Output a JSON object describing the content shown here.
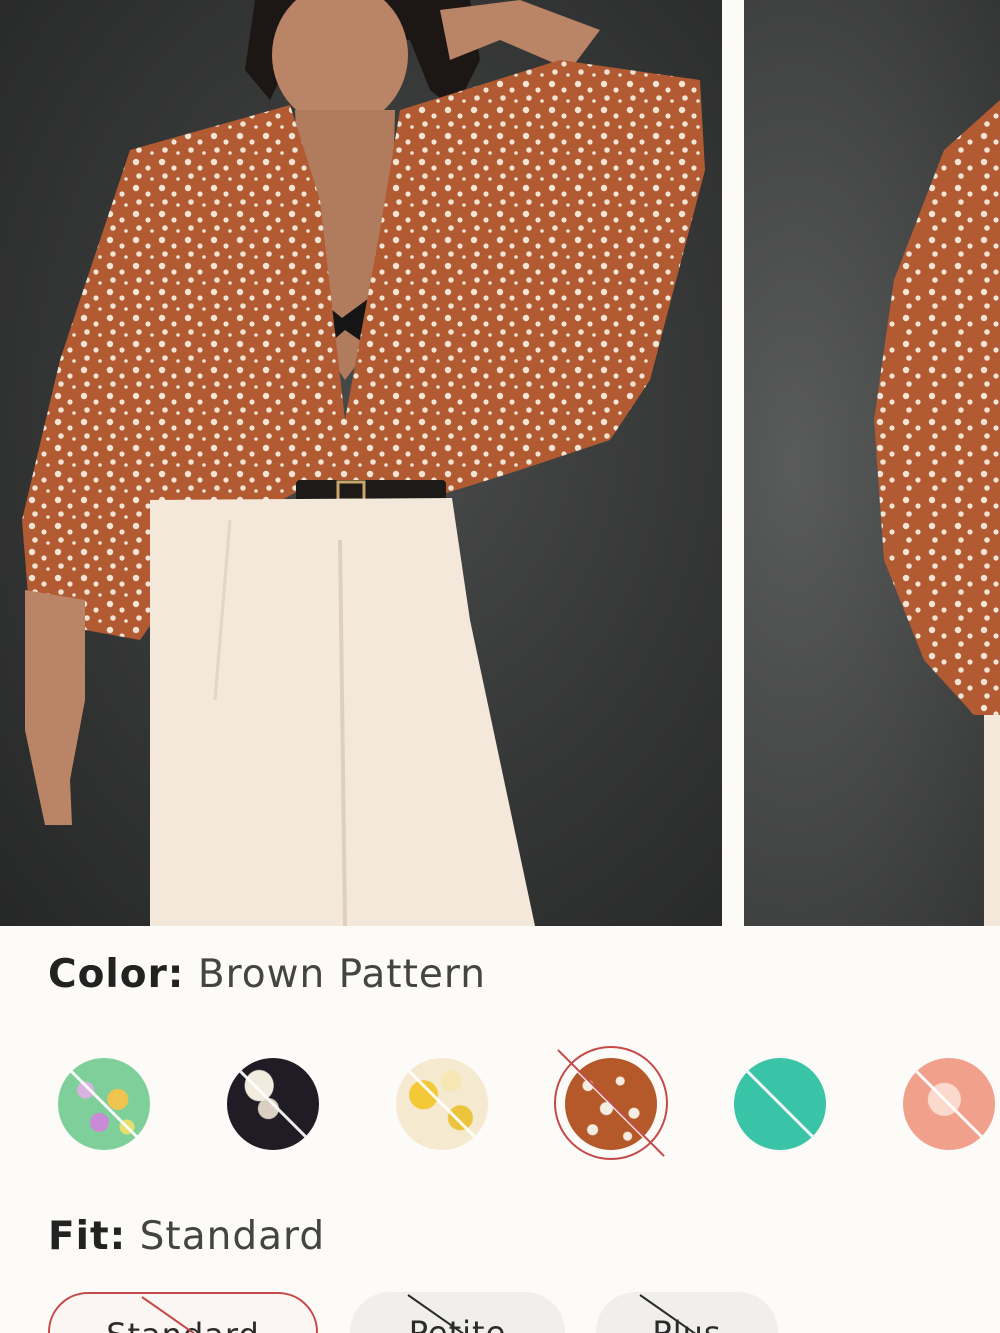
{
  "carousel": {
    "images": [
      {
        "alt": "model in brown pattern blouse and cream trousers, front view"
      },
      {
        "alt": "brown pattern blouse side view"
      }
    ]
  },
  "color": {
    "label": "Color:",
    "value": "Brown Pattern",
    "swatches": [
      {
        "name": "green-floral",
        "color": "#7fcf9a",
        "available": false
      },
      {
        "name": "navy-pattern",
        "color": "#1f1c26",
        "available": false
      },
      {
        "name": "yellow-floral",
        "color": "#f5e9cf",
        "available": false
      },
      {
        "name": "brown-pattern",
        "color": "#b5582a",
        "available": false,
        "selected": true
      },
      {
        "name": "teal",
        "color": "#39c3a7",
        "available": false
      },
      {
        "name": "peach-pattern",
        "color": "#f1a08c",
        "available": false
      }
    ]
  },
  "fit": {
    "label": "Fit:",
    "value": "Standard",
    "options": [
      {
        "label": "Standard",
        "selected": true,
        "available": false
      },
      {
        "label": "Petite",
        "selected": false,
        "available": false
      },
      {
        "label": "Plus",
        "selected": false,
        "available": false
      }
    ]
  },
  "colors": {
    "accent": "#c44a4a",
    "background": "#fcfbf8",
    "text": "#2b2b2b"
  }
}
